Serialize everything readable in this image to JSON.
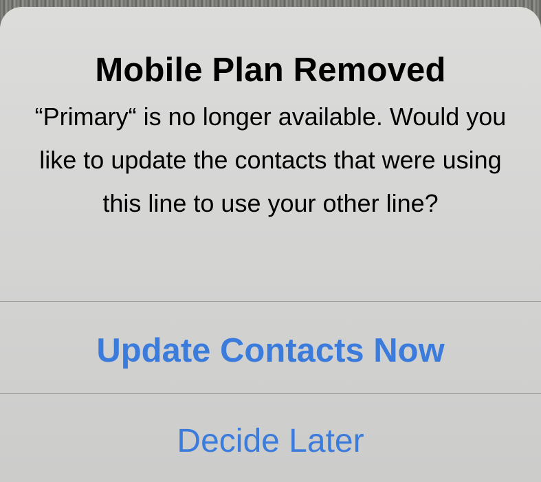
{
  "alert": {
    "title": "Mobile Plan Removed",
    "message": "“Primary“ is no longer available. Would you like to update the contacts that were using this line to use your other line?",
    "actions": [
      {
        "label": "Update Contacts Now",
        "style": "bold"
      },
      {
        "label": "Decide Later",
        "style": "regular"
      }
    ]
  },
  "colors": {
    "accent": "#3a7bdc",
    "alert_background": "#d6d6d5",
    "divider": "#9e9e9d",
    "title_text": "#000000"
  }
}
